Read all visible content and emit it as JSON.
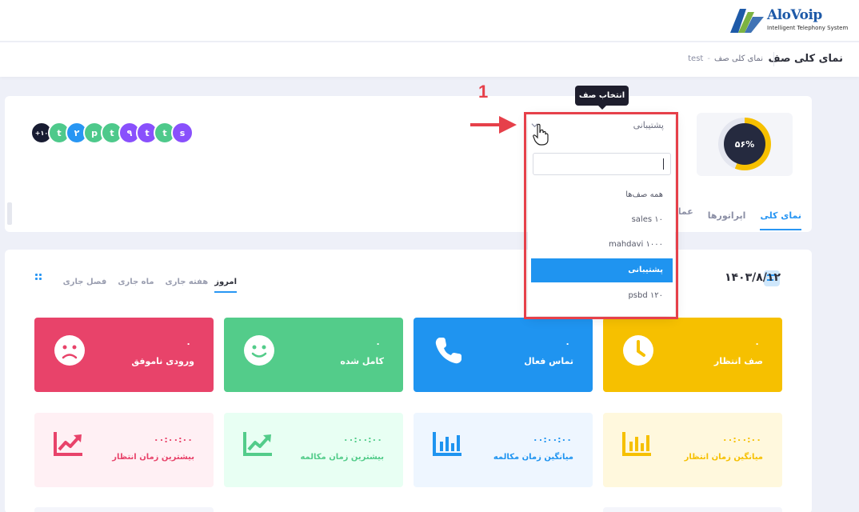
{
  "brand": {
    "name": "AloVoip",
    "tagline": "Intelligent Telephony System"
  },
  "header": {
    "title": "نمای کلی صف",
    "breadcrumb": {
      "root": "test",
      "separator": "-",
      "current": "نمای کلی صف"
    }
  },
  "overview": {
    "progress": {
      "value": 56,
      "label": "۵۶%"
    },
    "avatars": [
      {
        "letter": "s",
        "color": "#8950fc"
      },
      {
        "letter": "t",
        "color": "#4ec98b"
      },
      {
        "letter": "t",
        "color": "#8950fc"
      },
      {
        "letter": "۹",
        "color": "#8950fc"
      },
      {
        "letter": "t",
        "color": "#4ec98b"
      },
      {
        "letter": "p",
        "color": "#4ec98b"
      },
      {
        "letter": "۲",
        "color": "#2896f3"
      },
      {
        "letter": "t",
        "color": "#4ec98b"
      },
      {
        "letter": "+۱۰",
        "color": "#181c32"
      }
    ],
    "tabs": [
      {
        "label": "نمای کلی",
        "active": true
      },
      {
        "label": "اپراتورها",
        "active": false
      },
      {
        "label": "عملکرد",
        "active": false
      }
    ]
  },
  "queue_select": {
    "tooltip": "انتخاب صف",
    "selected": "پشتیبانی",
    "search_value": "",
    "options": [
      {
        "label": "همه صف‌ها",
        "active": false
      },
      {
        "label": "sales ۱۰",
        "active": false
      },
      {
        "label": "mahdavi ۱۰۰۰",
        "active": false
      },
      {
        "label": "پشتیبانی",
        "active": true
      },
      {
        "label": "psbd ۱۲۰",
        "active": false
      }
    ]
  },
  "annotation": {
    "step": "1"
  },
  "stats": {
    "date": "۱۴۰۳/۸/۱۲",
    "periods": [
      {
        "label": "امروز",
        "active": true
      },
      {
        "label": "هفته جاری",
        "active": false
      },
      {
        "label": "ماه جاری",
        "active": false
      },
      {
        "label": "فصل جاری",
        "active": false
      }
    ],
    "cards": [
      {
        "label": "صف انتظار",
        "value": "۰",
        "color": "#f6c000",
        "icon": "clock-icon"
      },
      {
        "label": "تماس فعال",
        "value": "۰",
        "color": "#1f94f0",
        "icon": "phone-icon"
      },
      {
        "label": "کامل شده",
        "value": "۰",
        "color": "#53cc8a",
        "icon": "smile-icon"
      },
      {
        "label": "ورودی ناموفق",
        "value": "۰",
        "color": "#e8436a",
        "icon": "sad-icon"
      }
    ],
    "times": [
      {
        "label": "میانگین زمان انتظار",
        "value": "۰۰:۰۰:۰۰",
        "color": "#f6c000",
        "bg": "#fff8dd",
        "icon": "bar-chart-icon"
      },
      {
        "label": "میانگین زمان مکالمه",
        "value": "۰۰:۰۰:۰۰",
        "color": "#1f94f0",
        "bg": "#eef6ff",
        "icon": "bar-chart-icon"
      },
      {
        "label": "بیشترین زمان مکالمه",
        "value": "۰۰:۰۰:۰۰",
        "color": "#53cc8a",
        "bg": "#e8fff3",
        "icon": "trend-up-icon"
      },
      {
        "label": "بیشترین زمان انتظار",
        "value": "۰۰:۰۰:۰۰",
        "color": "#e8436a",
        "bg": "#fff0f4",
        "icon": "trend-up-icon"
      }
    ]
  }
}
